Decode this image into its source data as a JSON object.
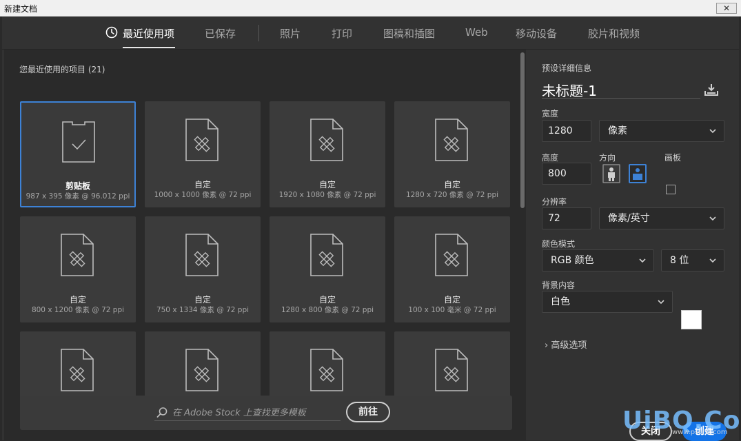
{
  "window": {
    "title": "新建文档",
    "close_glyph": "✕"
  },
  "tabs": [
    {
      "label": "最近使用项",
      "active": true
    },
    {
      "label": "已保存"
    },
    {
      "label": "照片"
    },
    {
      "label": "打印"
    },
    {
      "label": "图稿和插图"
    },
    {
      "label": "Web"
    },
    {
      "label": "移动设备"
    },
    {
      "label": "胶片和视频"
    }
  ],
  "recent": {
    "heading": "您最近使用的项目",
    "count": "(21)",
    "items": [
      {
        "name": "剪贴板",
        "meta": "987 x 395 像素 @ 96.012 ppi",
        "icon": "clipboard-icon",
        "selected": true
      },
      {
        "name": "自定",
        "meta": "1000 x 1000 像素 @ 72 ppi",
        "icon": "document-icon"
      },
      {
        "name": "自定",
        "meta": "1920 x 1080 像素 @ 72 ppi",
        "icon": "document-icon"
      },
      {
        "name": "自定",
        "meta": "1280 x 720 像素 @ 72 ppi",
        "icon": "document-icon"
      },
      {
        "name": "自定",
        "meta": "800 x 1200 像素 @ 72 ppi",
        "icon": "document-icon"
      },
      {
        "name": "自定",
        "meta": "750 x 1334 像素 @ 72 ppi",
        "icon": "document-icon"
      },
      {
        "name": "自定",
        "meta": "1280 x 800 像素 @ 72 ppi",
        "icon": "document-icon"
      },
      {
        "name": "自定",
        "meta": "100 x 100 毫米 @ 72 ppi",
        "icon": "document-icon"
      },
      {
        "name": "",
        "meta": "",
        "icon": "document-icon"
      },
      {
        "name": "",
        "meta": "",
        "icon": "document-icon"
      },
      {
        "name": "",
        "meta": "",
        "icon": "document-icon"
      },
      {
        "name": "",
        "meta": "",
        "icon": "document-icon"
      }
    ]
  },
  "stock": {
    "placeholder": "在 Adobe Stock 上查找更多模板",
    "go_label": "前往"
  },
  "preset": {
    "heading": "预设详细信息",
    "doc_title": "未标题-1",
    "width_label": "宽度",
    "width_value": "1280",
    "width_unit": "像素",
    "height_label": "高度",
    "height_value": "800",
    "orientation_label": "方向",
    "artboard_label": "画板",
    "resolution_label": "分辨率",
    "resolution_value": "72",
    "resolution_unit": "像素/英寸",
    "color_mode_label": "颜色模式",
    "color_mode_value": "RGB 颜色",
    "bit_depth_value": "8 位",
    "background_label": "背景内容",
    "background_value": "白色",
    "background_color": "#ffffff",
    "advanced_label": "高级选项"
  },
  "actions": {
    "close_label": "关闭",
    "create_label": "创建"
  },
  "watermark": {
    "brand": "UiBQ.CoM",
    "sub": "www.psahz.com"
  },
  "colors": {
    "accent": "#1473e6",
    "selection": "#3d82d6"
  }
}
